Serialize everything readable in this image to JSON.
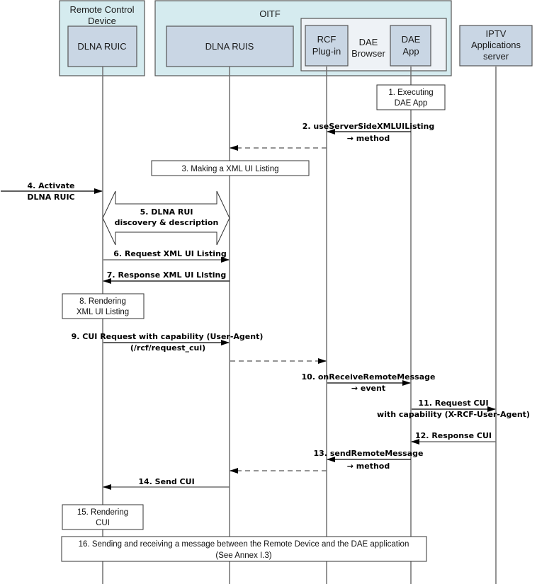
{
  "diagram": {
    "containers": {
      "remote_device": {
        "label_line1": "Remote Control",
        "label_line2": "Device"
      },
      "oitf": {
        "label": "OITF"
      },
      "dae_browser": {
        "label_line1": "DAE",
        "label_line2": "Browser"
      }
    },
    "participants": {
      "ruic": {
        "label": "DLNA RUIC"
      },
      "ruis": {
        "label": "DLNA RUIS"
      },
      "rcf": {
        "label_line1": "RCF",
        "label_line2": "Plug-in"
      },
      "dae_app": {
        "label_line1": "DAE",
        "label_line2": "App"
      },
      "iptv": {
        "label_line1": "IPTV",
        "label_line2": "Applications",
        "label_line3": "server"
      }
    },
    "steps": {
      "s1": {
        "line1": "1. Executing",
        "line2": "DAE App"
      },
      "s2": {
        "line1": "2. useServerSideXMLUIListing",
        "line2": "→ method"
      },
      "s3": {
        "line1": "3. Making a XML UI Listing"
      },
      "s4": {
        "line1": "4. Activate",
        "line2": "DLNA RUIC"
      },
      "s5": {
        "line1": "5. DLNA RUI",
        "line2": "discovery & description"
      },
      "s6": {
        "line1": "6. Request XML UI Listing"
      },
      "s7": {
        "line1": "7. Response XML UI Listing"
      },
      "s8": {
        "line1": "8. Rendering",
        "line2": "XML UI Listing"
      },
      "s9": {
        "line1": "9. CUI Request with capability (User-Agent)",
        "line2": "(/rcf/request_cui)"
      },
      "s10": {
        "line1": "10. onReceiveRemoteMessage",
        "line2": "→ event"
      },
      "s11": {
        "line1": "11. Request CUI",
        "line2": "with capability (X-RCF-User-Agent)"
      },
      "s12": {
        "line1": "12. Response CUI"
      },
      "s13": {
        "line1": "13. sendRemoteMessage",
        "line2": "→ method"
      },
      "s14": {
        "line1": "14. Send CUI"
      },
      "s15": {
        "line1": "15. Rendering",
        "line2": "CUI"
      },
      "s16": {
        "line1": "16. Sending and receiving a message between the Remote Device and the DAE application",
        "line2": "(See Annex I.3)"
      }
    },
    "colors": {
      "container_fill": "#d5ebef",
      "participant_fill": "#c9d6e4",
      "browser_fill": "#eef2f6",
      "line": "#707070"
    }
  }
}
